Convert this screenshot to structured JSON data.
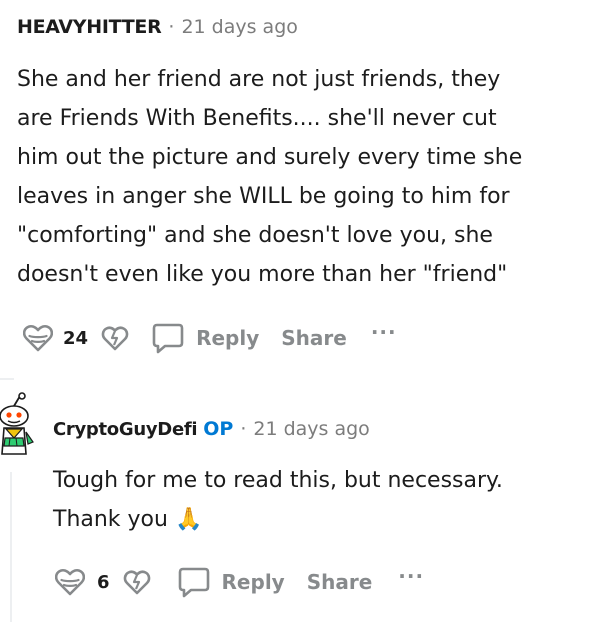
{
  "parent_comment": {
    "username": "HEAVYHITTER",
    "separator": "·",
    "timestamp": "21 days ago",
    "body": "She and her friend are not just friends, they\nare Friends With Benefits.... she'll never cut\nhim out the picture and surely every time she\nleaves in anger she WILL be going to him for\n\"comforting\" and she doesn't love you, she\ndoesn't even like you more than her \"friend\"",
    "actions": {
      "upvote_icon": "upvote-heart-icon",
      "vote_count": "24",
      "downvote_icon": "downvote-icon",
      "reply_icon": "comment-bubble-icon",
      "reply_label": "Reply",
      "share_label": "Share",
      "more_label": "···"
    }
  },
  "reply_comment": {
    "username": "CryptoGuyDefi",
    "op_badge": "OP",
    "separator": "·",
    "timestamp": "21 days ago",
    "body": "Tough for me to read this, but necessary.\nThank you",
    "emoji": "🙏",
    "avatar_icon": "snoo-avatar-icon",
    "actions": {
      "upvote_icon": "upvote-heart-icon",
      "vote_count": "6",
      "downvote_icon": "downvote-icon",
      "reply_icon": "comment-bubble-icon",
      "reply_label": "Reply",
      "share_label": "Share",
      "more_label": "···"
    }
  },
  "colors": {
    "text": "#1c1c1c",
    "meta": "#7c7c7c",
    "action": "#878a8c",
    "op": "#0079d3",
    "thread": "#edeff1"
  }
}
